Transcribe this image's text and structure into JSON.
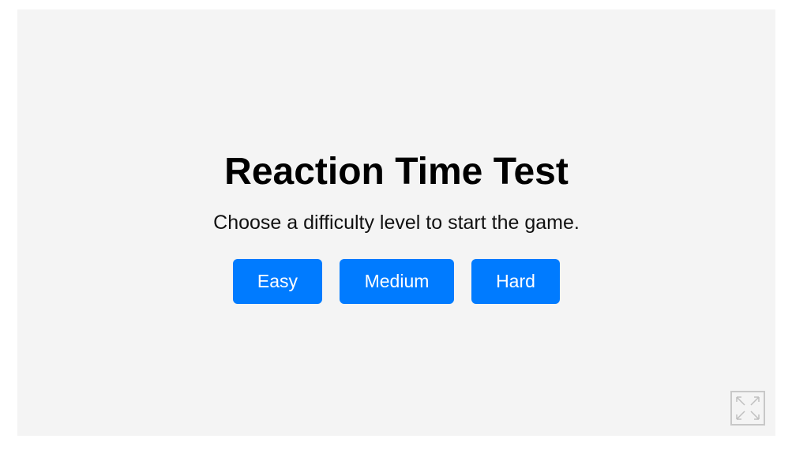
{
  "game": {
    "title": "Reaction Time Test",
    "subtitle": "Choose a difficulty level to start the game.",
    "buttons": {
      "easy": "Easy",
      "medium": "Medium",
      "hard": "Hard"
    },
    "fullscreen_icon": "fullscreen-icon"
  },
  "colors": {
    "background": "#f4f4f4",
    "button": "#007bff",
    "button_text": "#ffffff"
  }
}
